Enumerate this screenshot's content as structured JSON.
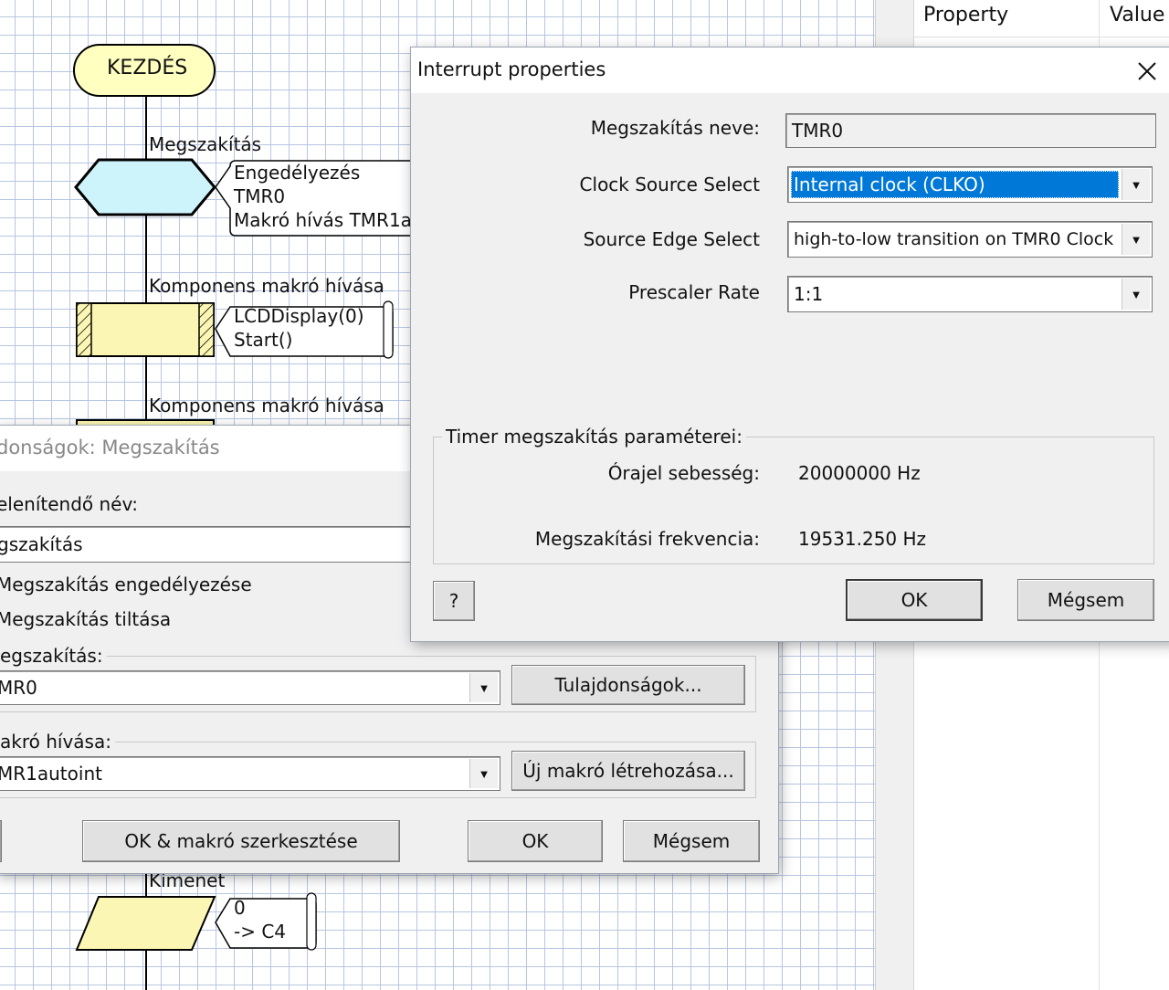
{
  "flowchart": {
    "start_label": "KEZDÉS",
    "interrupt_title": "Megszakítás",
    "interrupt_lines": [
      "Engedélyezés",
      "TMR0",
      "Makró hívás TMR1a"
    ],
    "component_macro_title_1": "Komponens makró hívása",
    "component_macro_lines_1": [
      "LCDDisplay(0)",
      "Start()"
    ],
    "component_macro_title_2": "Komponens makró hívása",
    "output_title": "Kimenet",
    "output_lines": [
      "0",
      "-> C4"
    ],
    "colors": {
      "start_fill": "#ffffc0",
      "interrupt_fill": "#cdf3fb",
      "macro_fill": "#fbf6b3",
      "grid": "#b7c6e0"
    }
  },
  "properties_panel": {
    "col_property": "Property",
    "col_value": "Value"
  },
  "interrupt_dialog": {
    "title": "Interrupt properties",
    "name_label": "Megszakítás neve:",
    "name_value": "TMR0",
    "clock_label": "Clock Source Select",
    "clock_value": "Internal clock (CLKO)",
    "edge_label": "Source Edge Select",
    "edge_value": "high-to-low transition on TMR0 Clock",
    "prescaler_label": "Prescaler Rate",
    "prescaler_value": "1:1",
    "group_title": "Timer megszakítás paraméterei:",
    "clock_speed_label": "Órajel sebesség:",
    "clock_speed_value": "20000000 Hz",
    "freq_label": "Megszakítási frekvencia:",
    "freq_value": "19531.250 Hz",
    "help_label": "?",
    "ok_label": "OK",
    "cancel_label": "Mégsem",
    "colors": {
      "selection": "#0078d7"
    }
  },
  "back_dialog": {
    "title": "donságok: Megszakítás",
    "display_name_label": "elenítendő név:",
    "display_name_value": "gszakítás",
    "radio_enable": "Megszakítás engedélyezése",
    "radio_disable": "Megszakítás tiltása",
    "interrupt_group": "egszakítás:",
    "interrupt_value": "MR0",
    "properties_btn": "Tulajdonságok...",
    "macro_group": "akró hívása:",
    "macro_value": "MR1autoint",
    "new_macro_btn": "Új makró létrehozása...",
    "ok_edit_btn": "OK & makró szerkesztése",
    "ok_btn": "OK",
    "cancel_btn": "Mégsem"
  }
}
